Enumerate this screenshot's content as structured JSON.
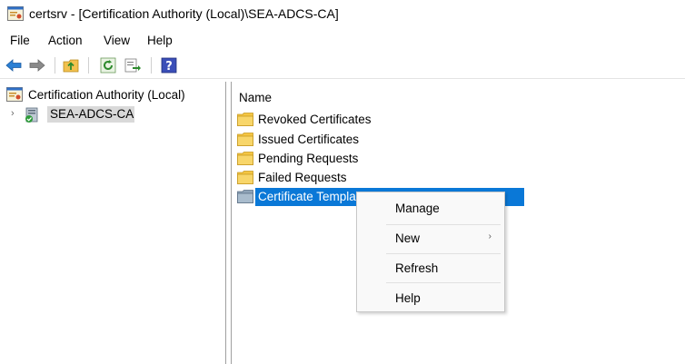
{
  "window": {
    "title": "certsrv - [Certification Authority (Local)\\SEA-ADCS-CA]"
  },
  "menu": [
    "File",
    "Action",
    "View",
    "Help"
  ],
  "toolbar": {
    "buttons": [
      "back-arrow-icon",
      "forward-arrow-icon",
      "up-folder-icon",
      "refresh-icon",
      "export-list-icon",
      "help-icon"
    ]
  },
  "tree": {
    "root": "Certification Authority (Local)",
    "child": "SEA-ADCS-CA"
  },
  "list": {
    "column_header": "Name",
    "items": [
      "Revoked Certificates",
      "Issued Certificates",
      "Pending Requests",
      "Failed Requests",
      "Certificate Templa"
    ]
  },
  "context_menu": {
    "items": [
      "Manage",
      "New",
      "Refresh",
      "Help"
    ],
    "submenu_arrow": "›"
  },
  "colors": {
    "selection": "#0a78d7",
    "tree_selection": "#d9d9d9",
    "folder": "#f4c542"
  }
}
